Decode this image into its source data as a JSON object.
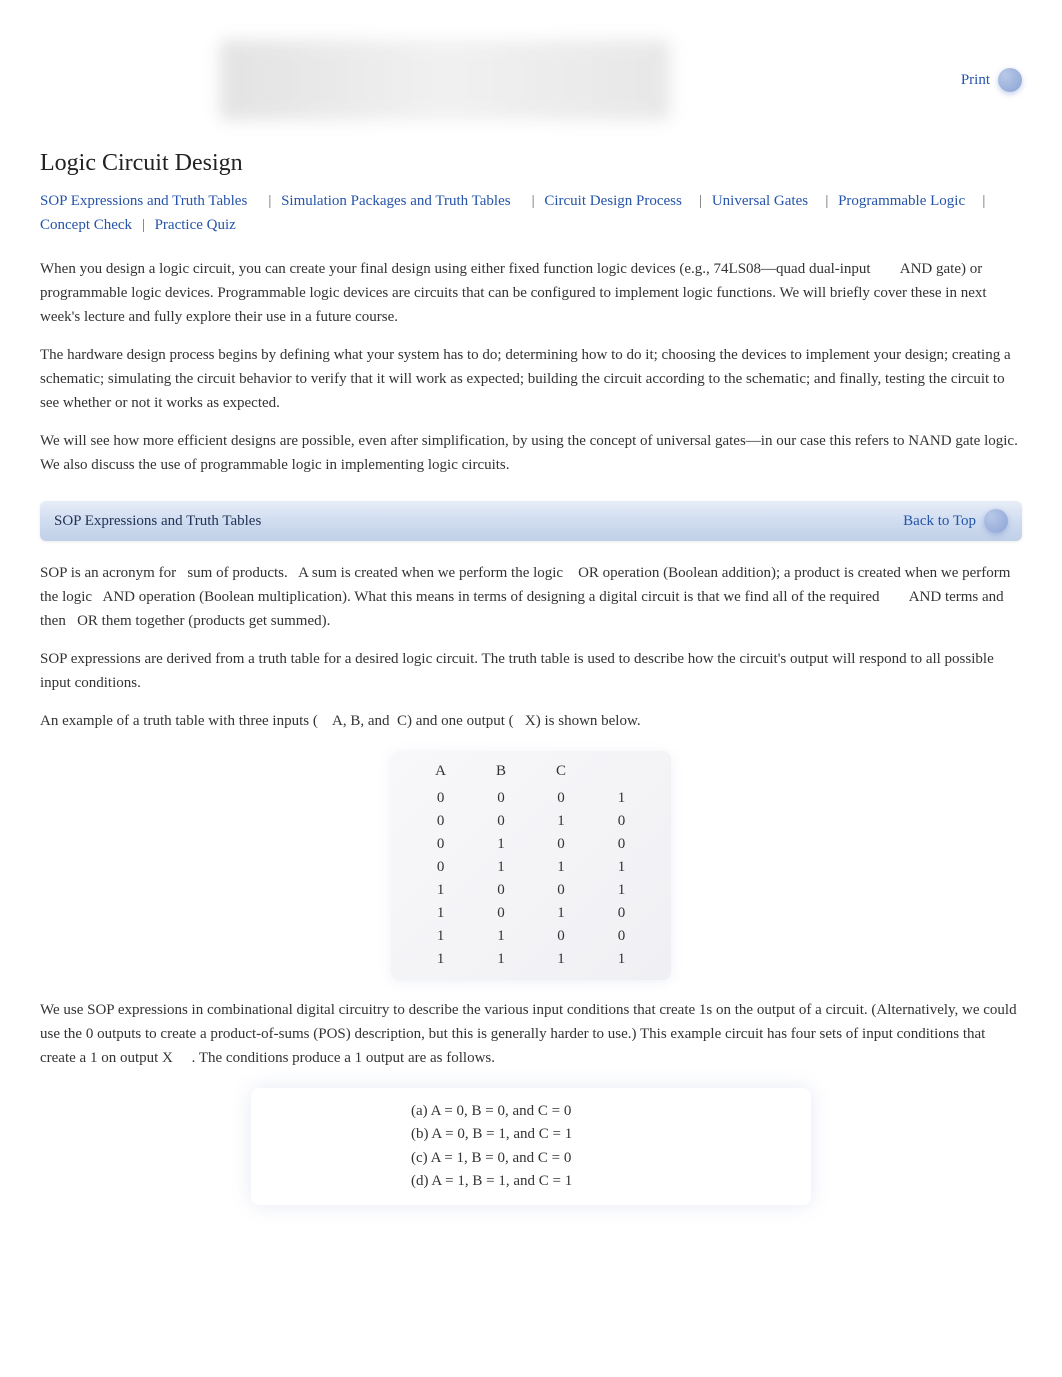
{
  "header": {
    "print_label": "Print"
  },
  "title": "Logic Circuit Design",
  "nav": [
    "SOP Expressions and Truth Tables",
    "Simulation Packages and Truth Tables",
    "Circuit Design Process",
    "Universal Gates",
    "Programmable Logic",
    "Concept Check",
    "Practice Quiz"
  ],
  "intro": {
    "p1": "When you design a logic circuit, you can create your final design using either fixed function logic devices (e.g., 74LS08—quad dual-input        AND gate) or programmable logic devices. Programmable logic devices are circuits that can be configured to implement logic functions. We will briefly cover these in next week's lecture and fully explore their use in a future course.",
    "p2": "The hardware design process begins by defining what your system has to do; determining how to do it; choosing the devices to implement your design; creating a schematic; simulating the circuit behavior to verify that it will work as expected; building the circuit according to the schematic; and finally, testing the circuit to see whether or not it works as expected.",
    "p3": "We will see how more efficient designs are possible, even after simplification, by using the concept of universal gates—in our case this refers to NAND gate logic. We also discuss the use of programmable logic in implementing logic circuits."
  },
  "section1": {
    "title": "SOP Expressions and Truth Tables",
    "back_label": "Back to Top"
  },
  "sop": {
    "p1": "SOP is an acronym for   sum of products.   A sum is created when we perform the logic    OR operation (Boolean addition); a product is created when we perform the logic   AND operation (Boolean multiplication). What this means in terms of designing a digital circuit is that we find all of the required        AND terms and then   OR them together (products get summed).",
    "p2": "SOP expressions are derived from a truth table for a desired logic circuit. The truth table is used to describe how the circuit's output will respond to all possible input conditions.",
    "p3": "An example of a truth table with three inputs (    A, B, and  C) and one output (   X) is shown below.",
    "p4": "We use SOP expressions in combinational digital circuitry to describe the various input conditions that create 1s on the output of a circuit. (Alternatively, we could use the 0 outputs to create a product-of-sums (POS) description, but this is generally harder to use.) This example circuit has four sets of input conditions that create a 1 on output X     . The conditions produce a 1 output are as follows."
  },
  "truth_table": {
    "headers": [
      "A",
      "B",
      "C",
      ""
    ],
    "rows": [
      [
        "0",
        "0",
        "0",
        "1"
      ],
      [
        "0",
        "0",
        "1",
        "0"
      ],
      [
        "0",
        "1",
        "0",
        "0"
      ],
      [
        "0",
        "1",
        "1",
        "1"
      ],
      [
        "1",
        "0",
        "0",
        "1"
      ],
      [
        "1",
        "0",
        "1",
        "0"
      ],
      [
        "1",
        "1",
        "0",
        "0"
      ],
      [
        "1",
        "1",
        "1",
        "1"
      ]
    ]
  },
  "conditions": [
    "(a)  A = 0,  B = 0, and   C = 0",
    "(b)  A = 0,  B = 1, and   C = 1",
    "(c)  A = 1,  B = 0, and   C = 0",
    "(d)  A = 1,  B = 1,  and C   = 1"
  ]
}
